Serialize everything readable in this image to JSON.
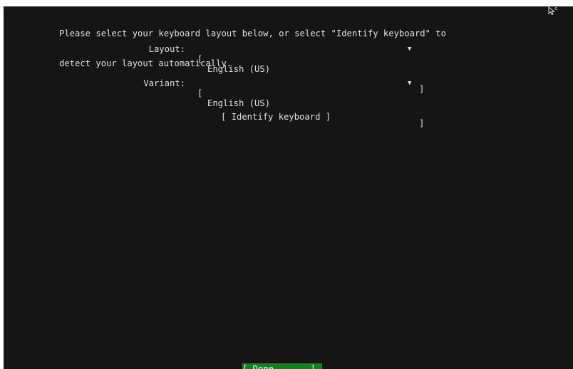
{
  "intro": {
    "line1": "Please select your keyboard layout below, or select \"Identify keyboard\" to",
    "line2": "detect your layout automatically."
  },
  "layout": {
    "label": "Layout:",
    "open_bracket": "[",
    "value": "English (US)",
    "arrow": "▼",
    "close_bracket": "]"
  },
  "variant": {
    "label": "Variant:",
    "open_bracket": "[",
    "value": "English (US)",
    "arrow": "▼",
    "close_bracket": "]"
  },
  "identify_button": "[ Identify keyboard ]",
  "done_button": "[ Done       ]",
  "colors": {
    "background": "#151515",
    "text": "#e0e0e0",
    "done_bg": "#0e8420"
  }
}
